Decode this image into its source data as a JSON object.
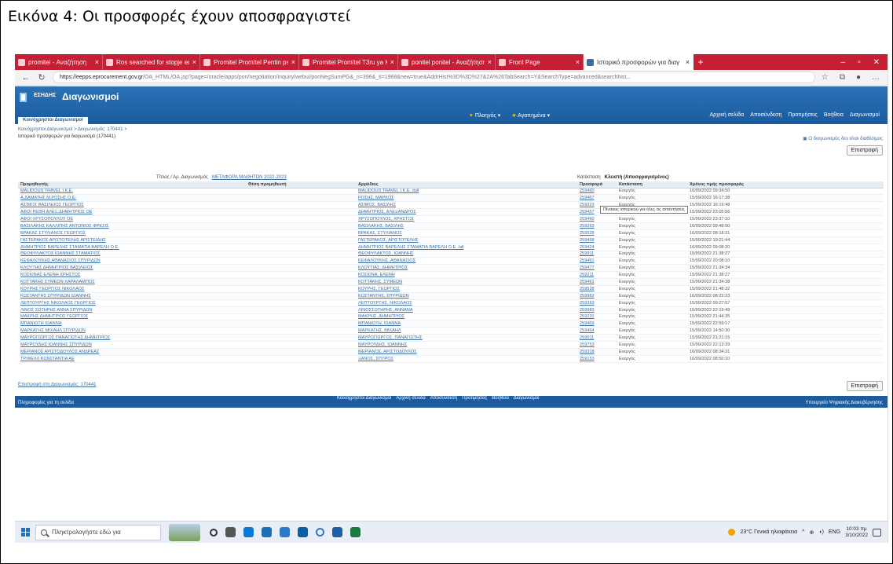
{
  "caption": "Εικόνα 4: Οι προσφορές έχουν αποσφραγιστεί",
  "browser": {
    "tabs": [
      {
        "label": "promitel - Αναζήτηση"
      },
      {
        "label": "Ros searched for stopje ensup"
      },
      {
        "label": "Promitel Promitel Pentin ps"
      },
      {
        "label": "Promitel Promitel T3ru ya Ko"
      },
      {
        "label": "ponitel ponitel - Αναζήτηση"
      },
      {
        "label": "Front Page"
      },
      {
        "label": "Ιστορικό προσφορών για διαγ"
      }
    ],
    "url_host": "https://eepps.eprocurement.gov.gr",
    "url_path": "/OA_HTML/OA.jsp?page=/oracle/apps/pon/negotiation/inquiry/webui/ponNegSumPG&_ri=396&_ti=1968&new=true&AddrHist%3D%3D%27&2A%26TabSearch=Y&SearchType=advanced&searchhist..."
  },
  "app": {
    "brand": "ΕΣΗΔΗΣ",
    "title": "Διαγωνισμοί",
    "menu": [
      "Πλοηγός",
      "Αγαπημένα"
    ],
    "global_links": [
      "Αρχική σελίδα",
      "Αποσύνδεση",
      "Προτιμήσεις",
      "Βοήθεια",
      "Διαγωνισμοί"
    ],
    "nav_tab": "Κοινόχρηστοι Διαγωνισμοί",
    "breadcrumb": "Κοινόχρηστοι Διαγωνισμοί >  Διαγωνισμός: 170441 >",
    "page_title": "Ιστορικό προσφορών για διαγωνισμό (170441)",
    "export_link": "Ο διαγωνισμός δεν είναι διαθέσιμος",
    "return_button": "Επιστροφή",
    "title_label": "Τίτλος / Αρ. Διαγωνισμός",
    "title_value": "ΜΕΤΑΦΟΡΑ ΜΑΘΗΤΩΝ 2022-2023",
    "status_label": "Κατάσταση",
    "status_value": "Κλειστή (Αποσφραγισμένος)",
    "tooltip": "Πίνακας ιστορικού για όλες τις απαντήσεις",
    "back_link": "Επιστροφή στη Διαγωνισμός: 170441",
    "footer_about": "Πληροφορίες για τη σελίδα",
    "footer_links": [
      "Κοινόχρηστοι Διαγωνισμοί",
      "Αρχική σελίδα",
      "Αποσύνδεση",
      "Προτιμήσεις",
      "Βοήθεια",
      "Διαγωνισμοί"
    ],
    "footer_copy": "Υπουργείο Ψηφιακής Διακυβέρνησης"
  },
  "table": {
    "headers": [
      "Προμηθευτής",
      "Θέση προμηθευτή",
      "Αρμόδιος",
      "Προσφορά",
      "Κατάσταση",
      "Χρόνος τιμής προσφοράς"
    ],
    "rows": [
      [
        "MALIDOUS TRAVEL Ι.Κ.Ε.",
        "",
        "MALIDOUS TRAVEL Ι.Κ.Ε. dull",
        "259460",
        "Ενεργός",
        "16/09/2022 09:34:50"
      ],
      [
        "Α.ΔΑΜΑΤΗΣ Μ.ΡΟΣΗΣ Ο.Ε.",
        "",
        "ΡΟΣΗΣ, ΜΑΡΚΟΣ",
        "259467",
        "Ενεργός",
        "15/09/2022 16:17:38"
      ],
      [
        "ΑΣΙΜΟΣ ΒΑΣΙΛΕΙΟΣ ΓΕΩΡΓΙΟΣ",
        "",
        "ΑΣΙΜΟΣ, ΒΑΣΙΛΗΣ",
        "259223",
        "Ενεργός",
        "15/09/2022 16:19:48"
      ],
      [
        "ΑΦΟΙ ΡΕΘΗ ΑΛΕΞ.ΔΗΜΗΤΡΙΟΣ ΟΕ",
        "",
        "ΔΗΜΗΤΡΙΟΣ, ΑΛΕΞΑΝΔΡΟΣ",
        "259457",
        "Ενεργός",
        "15/09/2022 23:05:56"
      ],
      [
        "ΑΦΟΙ ΧΡΥΣΟΠΟΥΛΟΥ ΟΕ",
        "",
        "ΧΡΥΣΟΠΟΥΛΟΣ, ΧΡΗΣΤΟΣ",
        "259460",
        "Ενεργός",
        "15/09/2022 23:37:10"
      ],
      [
        "ΒΑΣΙΛΑΚΗΣ ΚΑΛΛΙΠΗΣ ΑΝΤΩΝΙΟΣ ΦΡΕΣΙΣ",
        "",
        "ΒΑΣΙΛΑΚΗΣ, ΒΑΣΙΛΗΣ",
        "259263",
        "Ενεργός",
        "16/09/2022 09:48:00"
      ],
      [
        "ΒΡΑΚΑΣ ΣΤΥΛΙΑΝΟΣ ΓΕΩΡΓΙΟΣ",
        "",
        "ΒΡΑΚΑΣ, ΣΤΥΛΙΑΝΟΣ",
        "259528",
        "Ενεργός",
        "16/09/2022 08:18:31"
      ],
      [
        "ΓΑΣΤΕΡΑΚΟΣ ΑΡΙΣΤΟΤΕΛΗΣ ΑΡΙΣΤΕΙΔΗΣ",
        "",
        "ΓΑΣΤΕΡΑΚΟΣ, ΑΡΙΣΤΟΤΕΛΗΣ",
        "259468",
        "Ενεργός",
        "15/09/2022 19:21:44"
      ],
      [
        "ΔΗΜΗΤΡΙΟΣ ΒΑΡΕΛΗΣ ΣΤΑΜΑΤΙΑ ΒΑΡΕΛΗ Ο.Ε.",
        "",
        "ΔΗΜΗΤΡΙΟΣ ΒΑΡΕΛΗΣ ΣΤΑΜΑΤΙΑ ΒΑΡΕΛΗ Ο.Ε. /all",
        "259424",
        "Ενεργός",
        "16/09/2022 09:08:20"
      ],
      [
        "ΘΕΟΦΥΛΑΚΤΟΣ ΙΩΑΝΝΗΣ ΣΤΑΜΑΤΙΟΣ",
        "",
        "ΘΕΟΦΥΛΑΚΤΟΣ, ΙΩΑΝΝΗΣ",
        "259911",
        "Ενεργός",
        "15/09/2022 21:38:27"
      ],
      [
        "ΚΕΦΑΛΟΥΚΗΣ ΑΘΑΝΑΣΙΟΣ ΣΠΥΡΙΔΩΝ",
        "",
        "ΚΕΦΑΛΟΥΚΗΣ, ΑΘΑΝΑΣΙΟΣ",
        "259461",
        "Ενεργός",
        "15/09/2022 20:08:10"
      ],
      [
        "ΚΛΟΥΤΙΑΣ ΔΗΜΗΤΡΙΟΣ ΒΑΣΙΛΕΙΟΣ",
        "",
        "ΚΛΟΥΤΙΑΣ, ΔΗΜΗΤΡΙΟΣ",
        "259477",
        "Ενεργός",
        "15/09/2022 21:34:34"
      ],
      [
        "ΚΟΣΚΙΝΑΣ ΕΛΕΝΗ ΧΡΗΣΤΟΣ",
        "",
        "ΚΟΣΚΙΝΑ, ΕΛΕΝΗ",
        "259211",
        "Ενεργός",
        "15/09/2022 21:38:27"
      ],
      [
        "ΚΟΤΤΑΚΗΣ ΣΥΜΕΩΝ ΧΑΡΑΛΑΜΠΟΣ",
        "",
        "ΚΟΤΤΑΚΗΣ, ΣΥΜΕΩΝ",
        "259461",
        "Ενεργός",
        "15/09/2022 21:34:38"
      ],
      [
        "ΚΟΥΡΗΣ ΓΕΩΡΓΙΟΣ ΝΙΚΟΛΑΟΣ",
        "",
        "ΚΟΥΡΗΣ, ΓΕΩΡΓΙΟΣ",
        "259528",
        "Ενεργός",
        "15/09/2022 21:48:32"
      ],
      [
        "ΚΩΣΤΑΝΤΗΣ ΣΠΥΡΙΔΩΝ ΙΩΑΝΝΗΣ",
        "",
        "ΚΩΣΤΑΝΤΗΣ, ΣΠΥΡΙΔΩΝ",
        "259962",
        "Ενεργός",
        "16/09/2022 08:22:23"
      ],
      [
        "ΛΕΠΤΟΥΡΓΗΣ ΝΙΚΟΛΑΟΣ ΓΕΩΡΓΙΟΣ",
        "",
        "ΛΕΠΤΟΥΡΓΗΣ, ΝΙΚΟΛΑΟΣ",
        "259363",
        "Ενεργός",
        "15/09/2022 09:27:57"
      ],
      [
        "ΛΙΝΟΣ ΣΩΤΗΡΗΣ ΑΝΝΑ ΣΠΥΡΙΔΩΝ",
        "",
        "ΛΙΝΟΣΣΩΤΗΡΗΣ, ΑΝΝΑΝΑ",
        "259983",
        "Ενεργός",
        "15/09/2022 22:19:49"
      ],
      [
        "ΜΑΚΡΗΣ ΔΗΜΗΤΡΙΟΣ ΓΕΩΡΓΙΟΣ",
        "",
        "ΜΑΚΡΗΣ, ΔΗΜΗΤΡΙΟΣ",
        "259231",
        "Ενεργός",
        "15/09/2022 21:44:35"
      ],
      [
        "ΜΠΑΝΙΩΤΗ ΙΩΑΝΝΑ",
        "",
        "ΜΠΑΝΙΩΤΗ, ΙΩΑΝΝΑ",
        "259469",
        "Ενεργός",
        "15/09/2022 22:59:17"
      ],
      [
        "ΜΑΡΚΑΤΗΣ ΜΙΧΑΗΛ ΣΠΥΡΙΔΩΝ",
        "",
        "ΜΑΡΚΑΤΗΣ, ΜΙΧΑΗΛ",
        "259464",
        "Ενεργός",
        "15/09/2022 14:50:30"
      ],
      [
        "ΜΑΥΡΟΓΙΩΡΓΟΣ ΠΑΝΑΓΙΩΤΗΣ ΔΗΜΗΤΡΙΟΣ",
        "",
        "ΜΑΥΡΟΓΙΩΡΓΟΣ, ΠΑΝΑΓΙΩΤΗΣ",
        "259611",
        "Ενεργός",
        "15/09/2022 21:21:15"
      ],
      [
        "ΜΑΥΡΟΥΔΗΣ ΙΩΑΝΝΗΣ ΣΠΥΡΙΔΩΝ",
        "",
        "ΜΑΥΡΟΥΔΗΣ, ΙΩΑΝΝΗΣ",
        "259753",
        "Ενεργός",
        "15/09/2022 22:13:39"
      ],
      [
        "ΜΕΡΙΑΝΟΣ ΑΡΙΣΤΟΔΟΥΛΟΣ ΑΝΔΡΕΑΣ",
        "",
        "ΜΕΡΙΑΝΟΣ, ΑΡΙΣΤΟΔΟΥΛΟΣ",
        "259318",
        "Ενεργός",
        "16/09/2022 08:34:31"
      ],
      [
        "ΤΡΙΦΕΛΛ ΚΩΝΣΤΑΝΤΙΑ ΑΕ",
        "",
        "ΞΑΝΟΣ, ΣΠΥΡΟΣ",
        "259153",
        "Ενεργός",
        "16/09/2022 08:50:10"
      ]
    ]
  },
  "taskbar": {
    "search_placeholder": "Πληκτρολογήστε εδώ για",
    "weather": "23°C Γενικά ηλιοφάνεια",
    "lang": "ENG",
    "time": "10:03 πμ",
    "date": "3/10/2022"
  },
  "colors": {
    "tabbar": "#c41f34",
    "header": "#1b5b9e",
    "link": "#3a6ea5"
  }
}
